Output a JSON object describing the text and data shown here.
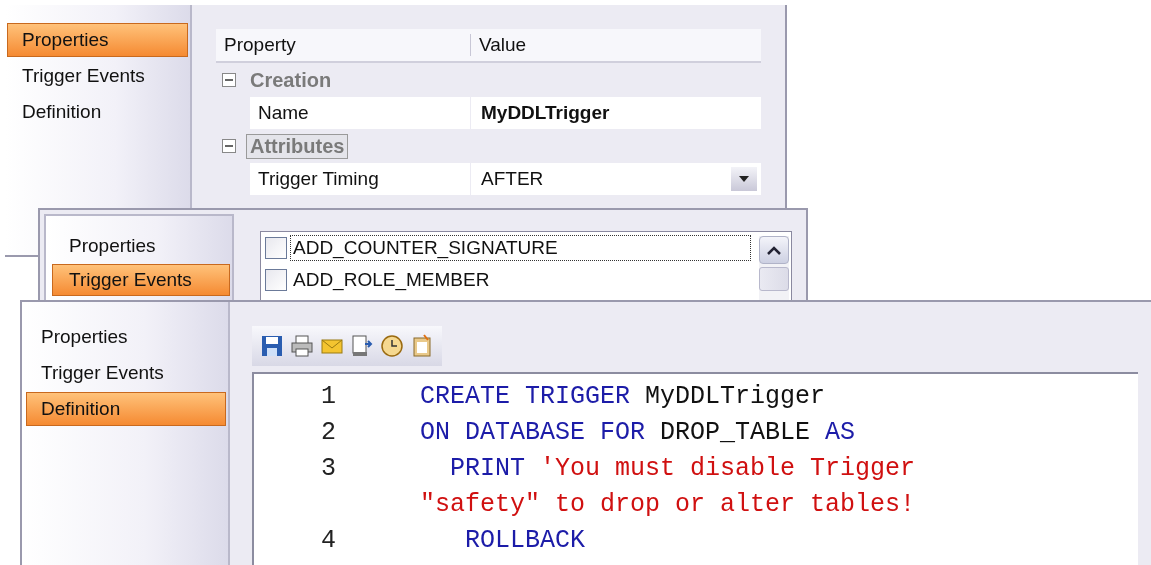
{
  "properties_panel": {
    "nav": [
      {
        "label": "Properties",
        "selected": true
      },
      {
        "label": "Trigger Events",
        "selected": false
      },
      {
        "label": "Definition",
        "selected": false
      }
    ],
    "grid": {
      "columns": [
        "Property",
        "Value"
      ],
      "groups": [
        {
          "label": "Creation",
          "expanded": true,
          "selected": false,
          "rows": [
            {
              "name": "Name",
              "value": "MyDDLTrigger",
              "bold": true,
              "kind": "text"
            }
          ]
        },
        {
          "label": "Attributes",
          "expanded": true,
          "selected": true,
          "rows": [
            {
              "name": "Trigger Timing",
              "value": "AFTER",
              "bold": false,
              "kind": "dropdown"
            }
          ]
        }
      ]
    }
  },
  "events_panel": {
    "nav": [
      {
        "label": "Properties",
        "selected": false
      },
      {
        "label": "Trigger Events",
        "selected": true
      }
    ],
    "events": [
      {
        "label": "ADD_COUNTER_SIGNATURE",
        "checked": false,
        "selected": true
      },
      {
        "label": "ADD_ROLE_MEMBER",
        "checked": false,
        "selected": false
      }
    ]
  },
  "definition_panel": {
    "nav": [
      {
        "label": "Properties",
        "selected": false
      },
      {
        "label": "Trigger Events",
        "selected": false
      },
      {
        "label": "Definition",
        "selected": true
      }
    ],
    "code": [
      {
        "number": "1",
        "segments": [
          {
            "kind": "keyword",
            "text": "CREATE TRIGGER"
          },
          {
            "kind": "plain",
            "text": " MyDDLTrigger"
          }
        ]
      },
      {
        "number": "2",
        "segments": [
          {
            "kind": "keyword",
            "text": "ON DATABASE FOR"
          },
          {
            "kind": "plain",
            "text": " DROP_TABLE "
          },
          {
            "kind": "keyword",
            "text": "AS"
          }
        ]
      },
      {
        "number": "3",
        "segments": [
          {
            "kind": "keyword",
            "text": "  PRINT"
          },
          {
            "kind": "string",
            "text": " 'You must disable Trigger"
          }
        ]
      },
      {
        "segments": [
          {
            "kind": "string",
            "text": "\"safety\" to drop or alter tables!"
          }
        ]
      },
      {
        "number": "4",
        "segments": [
          {
            "kind": "keyword",
            "text": "   ROLLBACK"
          }
        ]
      }
    ]
  }
}
